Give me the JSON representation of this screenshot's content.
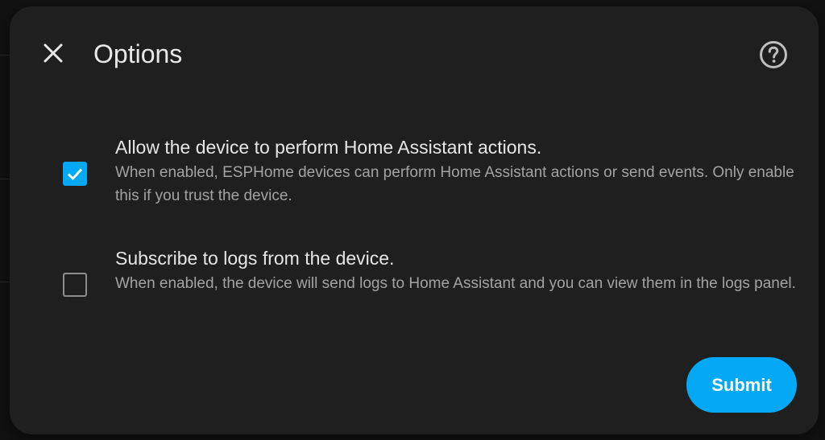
{
  "dialog": {
    "title": "Options",
    "close_icon": "close-icon",
    "help_icon": "help-circle-icon",
    "submit_label": "Submit",
    "accent_color": "#03a9f4"
  },
  "options": [
    {
      "checked": true,
      "label": "Allow the device to perform Home Assistant actions.",
      "description": "When enabled, ESPHome devices can perform Home Assistant actions or send events. Only enable this if you trust the device."
    },
    {
      "checked": false,
      "label": "Subscribe to logs from the device.",
      "description": "When enabled, the device will send logs to Home Assistant and you can view them in the logs panel."
    }
  ]
}
